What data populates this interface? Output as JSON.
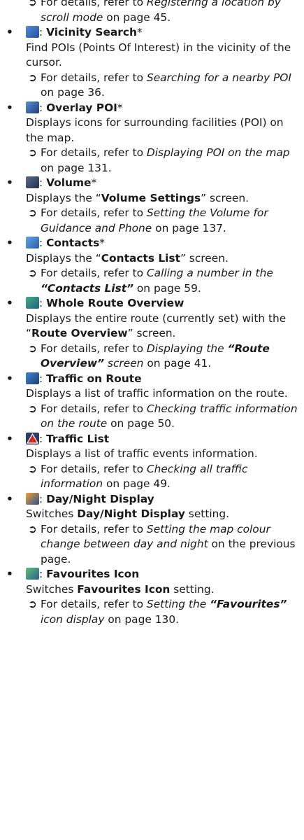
{
  "top_ref": {
    "arrow": "➲",
    "prefix": "For details, refer to ",
    "link": "Registering a location by scroll mode",
    "suffix": " on page 45."
  },
  "items": [
    {
      "icon": "binoculars-icon",
      "color": "#3f72c7",
      "bullet": "•",
      "sep": ": ",
      "title": "Vicinity Search",
      "star": "*",
      "desc": "Find POIs (Points Of Interest) in the vicinity of the cursor.",
      "ref": {
        "prefix": "For details, refer to ",
        "link": "Searching for a nearby POI",
        "suffix": " on page 36."
      }
    },
    {
      "icon": "poi-icon",
      "color": "#2c5aa8",
      "bullet": "•",
      "sep": ": ",
      "title": "Overlay POI",
      "star": "*",
      "desc": "Displays icons for surrounding facilities (POI) on the map.",
      "ref": {
        "prefix": "For details, refer to ",
        "link": "Displaying POI on the map",
        "suffix": " on page 131."
      }
    },
    {
      "icon": "volume-icon",
      "color": "#34456a",
      "bullet": "•",
      "sep": ": ",
      "title": "Volume",
      "star": "*",
      "desc_a": "Displays the “",
      "desc_b": "Volume Settings",
      "desc_c": "” screen.",
      "ref": {
        "prefix": "For details, refer to ",
        "link": "Setting the Volume for Guidance and Phone",
        "suffix": " on page 137."
      }
    },
    {
      "icon": "contacts-icon",
      "color": "#3b79c6",
      "bullet": "•",
      "sep": ": ",
      "title": "Contacts",
      "star": "*",
      "desc_a": "Displays the “",
      "desc_b": "Contacts List",
      "desc_c": "” screen.",
      "ref": {
        "prefix": "For details, refer to ",
        "link_a": "Calling a number in the ",
        "link_b": "“Contacts List”",
        "suffix": " on page 59."
      }
    },
    {
      "icon": "route-overview-icon",
      "color": "#2a8c5a",
      "bullet": "•",
      "sep": ": ",
      "title": "Whole Route Overview",
      "desc_a": "Displays the entire route (currently set) with the “",
      "desc_b": "Route Overview",
      "desc_c": "” screen.",
      "ref": {
        "prefix": "For details, refer to ",
        "link_a": "Displaying the ",
        "link_b": "“Route Overview”",
        "link_c": " screen",
        "suffix": " on page 41."
      }
    },
    {
      "icon": "traffic-route-icon",
      "color": "#2b6cb3",
      "bullet": "•",
      "sep": ": ",
      "title": "Traffic on Route",
      "desc": "Displays a list of traffic information on the route.",
      "ref": {
        "prefix": "For details, refer to ",
        "link": "Checking traffic information on the route",
        "suffix": " on page 50."
      }
    },
    {
      "icon": "traffic-warning-icon",
      "color": "#c8221f",
      "bullet": "•",
      "sep": ": ",
      "title": "Traffic List",
      "desc": "Displays a list of traffic events information.",
      "ref": {
        "prefix": "For details, refer to ",
        "link": "Checking all traffic information",
        "suffix": " on page 49."
      }
    },
    {
      "icon": "day-night-icon",
      "color": "#d9792a",
      "bullet": "•",
      "sep": ": ",
      "title": "Day/Night Display",
      "desc_a": "Switches ",
      "desc_b": "Day/Night Display",
      "desc_c": " setting.",
      "ref": {
        "prefix": "For details, refer to ",
        "link": "Setting the map colour change between day and night",
        "suffix": " on the previous page."
      }
    },
    {
      "icon": "favourites-icon",
      "color": "#3a8c4c",
      "bullet": "•",
      "sep": ": ",
      "title": "Favourites Icon",
      "desc_a": "Switches ",
      "desc_b": "Favourites Icon",
      "desc_c": " setting.",
      "ref": {
        "prefix": "For details, refer to ",
        "link_a": "Setting the ",
        "link_b": "“Favourites”",
        "link_c": " icon display",
        "suffix": " on page 130."
      }
    }
  ]
}
